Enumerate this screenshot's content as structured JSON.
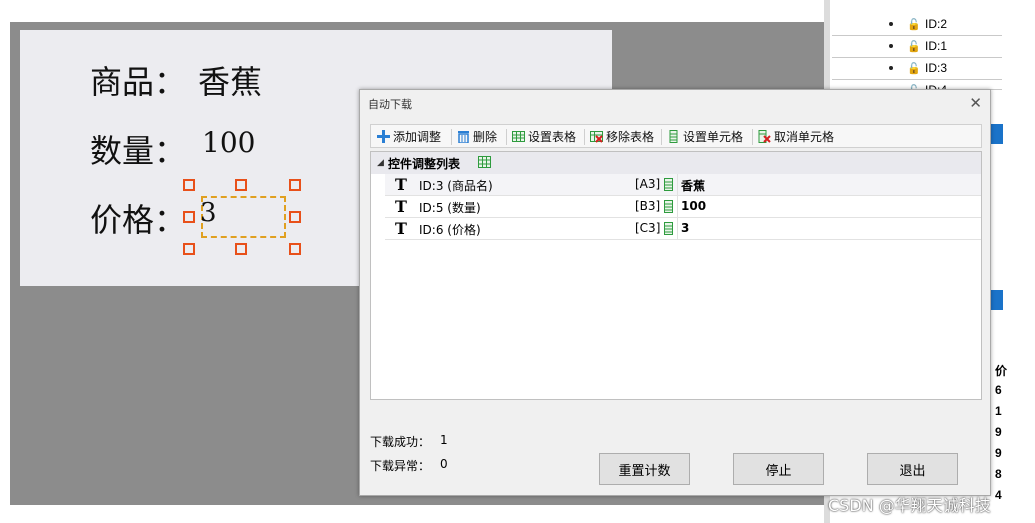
{
  "canvas": {
    "label_card": {
      "product_label": "商品：",
      "product_value": "香蕉",
      "quantity_label": "数量：",
      "quantity_value": "100",
      "price_label": "价格：",
      "price_value": "3"
    }
  },
  "right_panel": {
    "items": [
      {
        "id": "ID:2"
      },
      {
        "id": "ID:1"
      },
      {
        "id": "ID:3"
      },
      {
        "id": "ID:4"
      }
    ],
    "column_chars": [
      "价",
      "6",
      "1",
      "9",
      "9",
      "8",
      "4"
    ]
  },
  "dialog": {
    "title": "自动下载",
    "close_glyph": "✕",
    "toolbar": {
      "add": "添加调整",
      "delete": "删除",
      "set_table": "设置表格",
      "remove_table": "移除表格",
      "set_cell": "设置单元格",
      "cancel_cell": "取消单元格"
    },
    "list": {
      "header": "控件调整列表",
      "rows": [
        {
          "type_glyph": "T",
          "id": "ID:3 (商品名)",
          "cell": "[A3]",
          "value": "香蕉"
        },
        {
          "type_glyph": "T",
          "id": "ID:5 (数量)",
          "cell": "[B3]",
          "value": "100"
        },
        {
          "type_glyph": "T",
          "id": "ID:6 (价格)",
          "cell": "[C3]",
          "value": "3"
        }
      ]
    },
    "status": {
      "success_label": "下载成功：",
      "success_value": "1",
      "error_label": "下载异常：",
      "error_value": "0"
    },
    "buttons": {
      "reset": "重置计数",
      "stop": "停止",
      "exit": "退出"
    }
  },
  "watermark": "CSDN @华翔天诚科技",
  "colors": {
    "canvas_bg": "#8c8c8c",
    "label_card_bg": "#ececf0",
    "handle": "#e8501a",
    "selection_border": "#e0a020",
    "accent_blue": "#1a73c9",
    "sheet_green": "#2e9b3e"
  },
  "icons": {
    "add": "plus-icon",
    "delete": "trash-icon",
    "set_table": "table-icon",
    "remove_table": "table-remove-icon",
    "set_cell": "cell-icon",
    "cancel_cell": "cell-cancel-icon",
    "row_type": "text-type-icon",
    "row_sheet": "sheet-icon",
    "lock": "lock-icon"
  }
}
